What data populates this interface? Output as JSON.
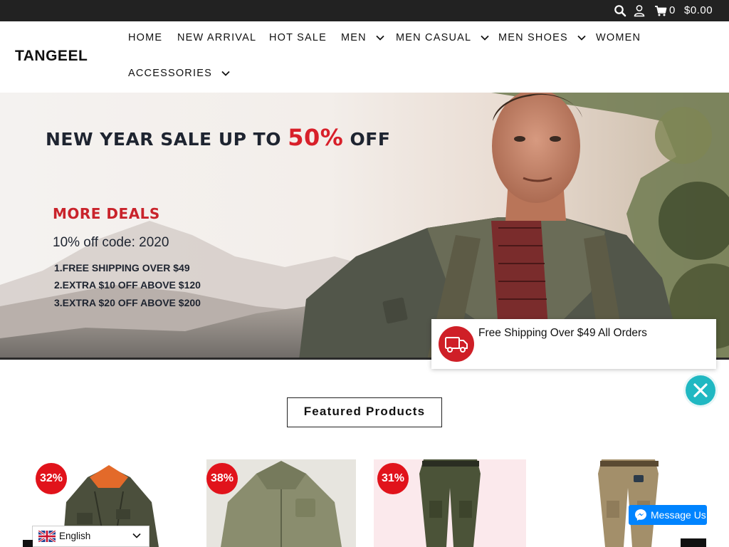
{
  "topbar": {
    "search_icon": "search-icon",
    "user_icon": "user-icon",
    "cart_icon": "cart-icon",
    "cart_count": "0",
    "cart_total": "$0.00"
  },
  "header": {
    "logo": "TANGEEL",
    "nav": [
      {
        "label": "HOME"
      },
      {
        "label": "NEW ARRIVAL"
      },
      {
        "label": "HOT SALE"
      },
      {
        "label": "MEN"
      },
      {
        "label": "MEN CASUAL"
      },
      {
        "label": "MEN SHOES"
      },
      {
        "label": "WOMEN"
      },
      {
        "label": "ACCESSORIES"
      }
    ]
  },
  "hero": {
    "headline_prefix": "NEW YEAR SALE UP TO",
    "headline_highlight": "50%",
    "headline_suffix": "OFF",
    "more_deals": "MORE  DEALS",
    "code_line": "10% off code: 2020",
    "deals": [
      "1.FREE SHIPPING OVER $49",
      "2.EXTRA $10 OFF ABOVE $120",
      "3.EXTRA $20 OFF ABOVE $200"
    ]
  },
  "shipping_popup": {
    "text": "Free Shipping Over $49 All Orders"
  },
  "featured": {
    "title": "Featured Products"
  },
  "products": [
    {
      "discount": "32%"
    },
    {
      "discount": "38%"
    },
    {
      "discount": "31%"
    },
    {
      "discount": ""
    }
  ],
  "language": {
    "label": "English"
  },
  "messenger": {
    "label": "Message Us"
  },
  "colors": {
    "topbar": "#222222",
    "badge": "#e1131b",
    "accent_teal": "#20b8c2",
    "messenger_blue": "#0084ff",
    "hero_red": "#d8202a"
  }
}
